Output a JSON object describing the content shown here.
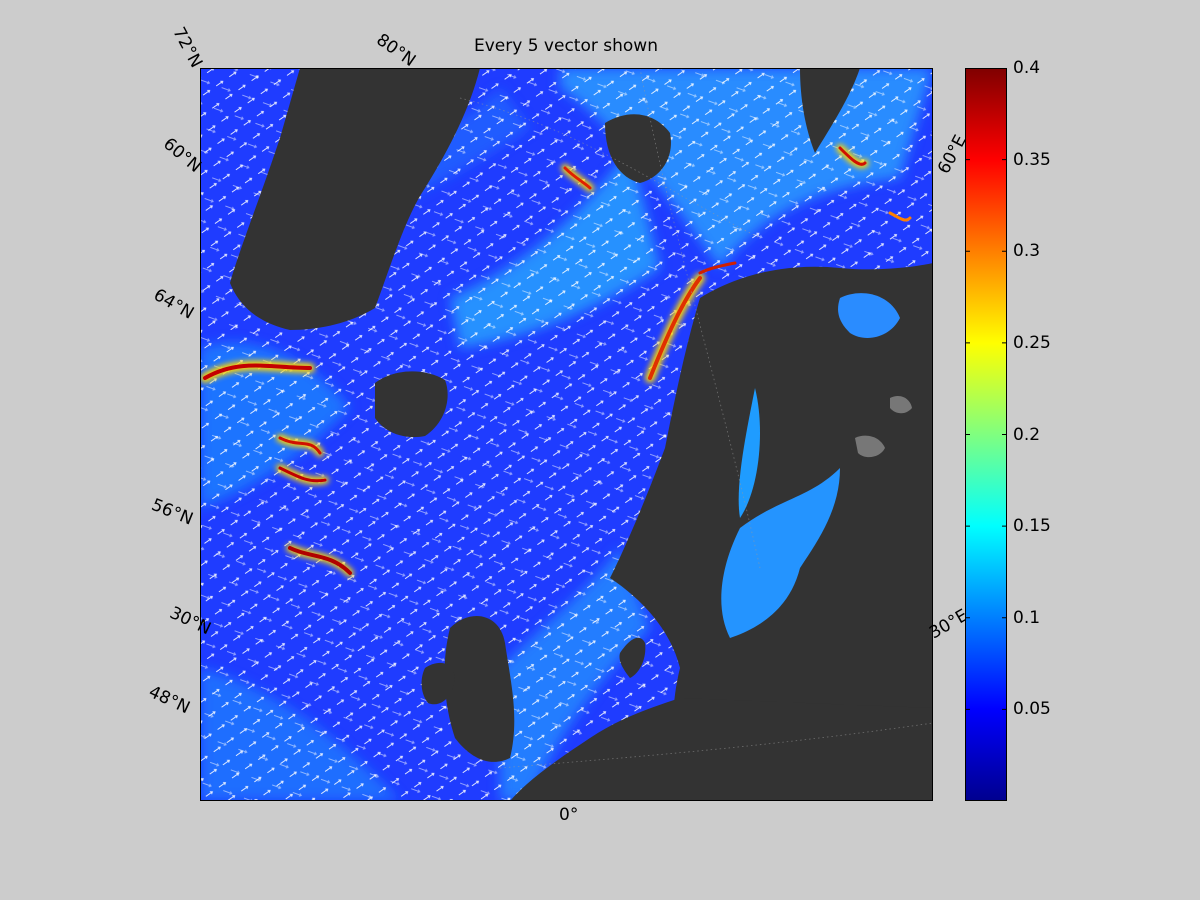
{
  "title": "Every 5 vector shown",
  "map": {
    "type": "ocean surface current speed with vector arrows",
    "vector_subsample": 5,
    "lat_labels": [
      "72°N",
      "60°N",
      "64°N",
      "56°N",
      "30°N",
      "48°N"
    ],
    "lon_labels": [
      "80°N",
      "0°",
      "30°E",
      "60°E"
    ],
    "land_color": "#333333",
    "background_color": "#cccccc",
    "colormap": "jet"
  },
  "colorbar": {
    "min": 0,
    "max": 0.4,
    "ticks": [
      "0.4",
      "0.35",
      "0.3",
      "0.25",
      "0.2",
      "0.15",
      "0.1",
      "0.05"
    ],
    "tick_values": [
      0.4,
      0.35,
      0.3,
      0.25,
      0.2,
      0.15,
      0.1,
      0.05
    ]
  }
}
